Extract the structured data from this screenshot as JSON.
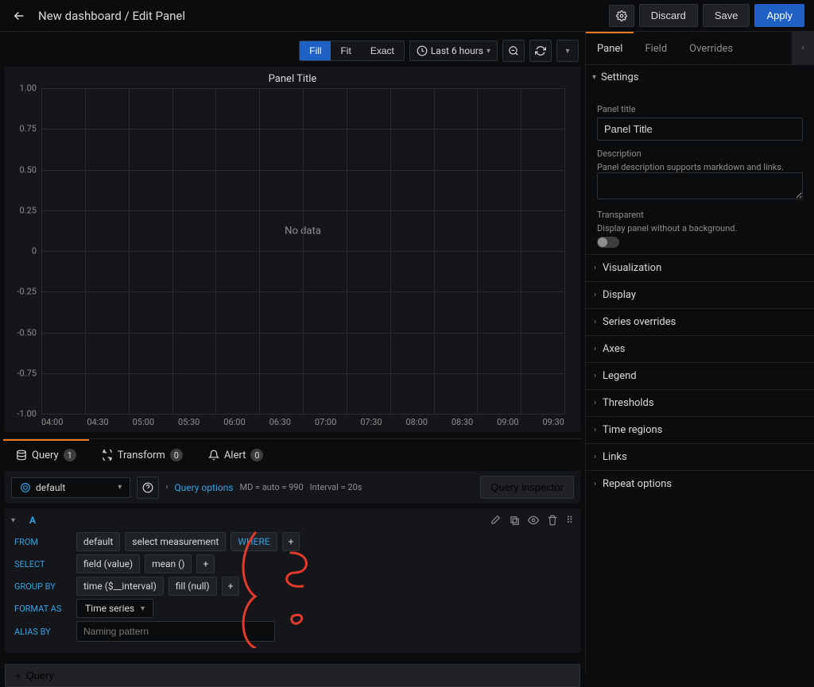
{
  "header": {
    "title": "New dashboard / Edit Panel",
    "discard": "Discard",
    "save": "Save",
    "apply": "Apply"
  },
  "viz_toolbar": {
    "fill": "Fill",
    "fit": "Fit",
    "exact": "Exact",
    "time_range": "Last 6 hours"
  },
  "chart": {
    "title": "Panel Title",
    "no_data": "No data",
    "y_ticks": [
      "1.00",
      "0.75",
      "0.50",
      "0.25",
      "0",
      "-0.25",
      "-0.50",
      "-0.75",
      "-1.00"
    ],
    "x_ticks": [
      "04:00",
      "04:30",
      "05:00",
      "05:30",
      "06:00",
      "06:30",
      "07:00",
      "07:30",
      "08:00",
      "08:30",
      "09:00",
      "09:30"
    ]
  },
  "bottom_tabs": {
    "query": "Query",
    "query_count": "1",
    "transform": "Transform",
    "transform_count": "0",
    "alert": "Alert",
    "alert_count": "0"
  },
  "datasource": {
    "name": "default"
  },
  "query_options": {
    "link": "Query options",
    "md_text": "MD = auto = 990",
    "interval_text": "Interval = 20s",
    "inspector": "Query inspector"
  },
  "queryA": {
    "id": "A",
    "labels": {
      "from": "FROM",
      "select": "SELECT",
      "group_by": "GROUP BY",
      "format_as": "FORMAT AS",
      "alias_by": "ALIAS BY"
    },
    "from_default": "default",
    "from_measurement": "select measurement",
    "from_where": "WHERE",
    "select_field": "field (value)",
    "select_mean": "mean ()",
    "group_time": "time ($__interval)",
    "group_fill": "fill (null)",
    "format_as_value": "Time series",
    "alias_placeholder": "Naming pattern"
  },
  "add_query": "Query",
  "right_tabs": {
    "panel": "Panel",
    "field": "Field",
    "overrides": "Overrides"
  },
  "settings": {
    "heading": "Settings",
    "panel_title_label": "Panel title",
    "panel_title_value": "Panel Title",
    "description_label": "Description",
    "description_hint": "Panel description supports markdown and links.",
    "transparent_label": "Transparent",
    "transparent_hint": "Display panel without a background."
  },
  "collapsed": [
    "Visualization",
    "Display",
    "Series overrides",
    "Axes",
    "Legend",
    "Thresholds",
    "Time regions",
    "Links",
    "Repeat options"
  ],
  "chart_data": {
    "type": "line",
    "title": "Panel Title",
    "x": [
      "04:00",
      "04:30",
      "05:00",
      "05:30",
      "06:00",
      "06:30",
      "07:00",
      "07:30",
      "08:00",
      "08:30",
      "09:00",
      "09:30"
    ],
    "series": [],
    "ylim": [
      -1.0,
      1.0
    ],
    "xlabel": "",
    "ylabel": "",
    "no_data": true
  }
}
